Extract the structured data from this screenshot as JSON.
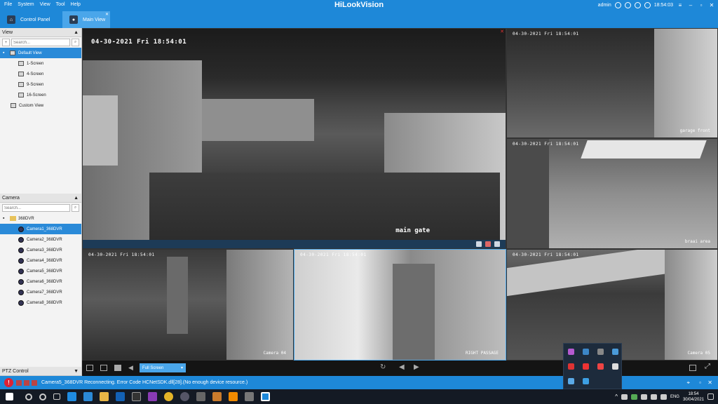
{
  "window": {
    "title": "HiLookVision",
    "menu": [
      "File",
      "System",
      "View",
      "Tool",
      "Help"
    ],
    "user": "admin",
    "time": "18:54:03"
  },
  "tabs": [
    {
      "label": "Control Panel"
    },
    {
      "label": "Main View"
    }
  ],
  "left_panel": {
    "view_header": "View",
    "view_search_placeholder": "Search...",
    "views": [
      {
        "label": "Default View"
      },
      {
        "label": "1-Screen"
      },
      {
        "label": "4-Screen"
      },
      {
        "label": "9-Screen"
      },
      {
        "label": "16-Screen"
      },
      {
        "label": "Custom View"
      }
    ],
    "camera_header": "Camera",
    "camera_search_placeholder": "Search...",
    "device": "368DVR",
    "cameras": [
      {
        "label": "Camera1_368DVR"
      },
      {
        "label": "Camera2_368DVR"
      },
      {
        "label": "Camera3_368DVR"
      },
      {
        "label": "Camera4_368DVR"
      },
      {
        "label": "Camera5_368DVR"
      },
      {
        "label": "Camera6_368DVR"
      },
      {
        "label": "Camera7_368DVR"
      },
      {
        "label": "Camera8_368DVR"
      }
    ],
    "ptz_header": "PTZ Control"
  },
  "cells": [
    {
      "osd": "04-30-2021 Fri 18:54:01",
      "label": "main gate"
    },
    {
      "osd": "04-30-2021 Fri 18:54:01",
      "label": "garage front"
    },
    {
      "osd": "04-30-2021 Fri 18:54:01",
      "label": "braai area"
    },
    {
      "osd": "04-30-2021 Fri 18:54:01",
      "label": ""
    },
    {
      "osd": "04-30-2021 Fri 18:54:01",
      "label": "Camera 04"
    },
    {
      "osd": "04-30-2021 Fri 18:54:01",
      "label": "RIGHT PASSAGE"
    },
    {
      "osd": "04-30-2021 Fri 18:54:01",
      "label": "Camera 05"
    }
  ],
  "bottombar": {
    "mode": "Full Screen"
  },
  "status": {
    "message": "Camera5_368DVR Reconnecting. Error Code HCNetSDK.dll[28].(No enough device resource.)"
  },
  "taskbar": {
    "lang": "ENG",
    "time": "18:54",
    "date": "30/04/2021"
  },
  "colors": {
    "accent": "#1e88d8",
    "selected": "#2a8ad8"
  }
}
